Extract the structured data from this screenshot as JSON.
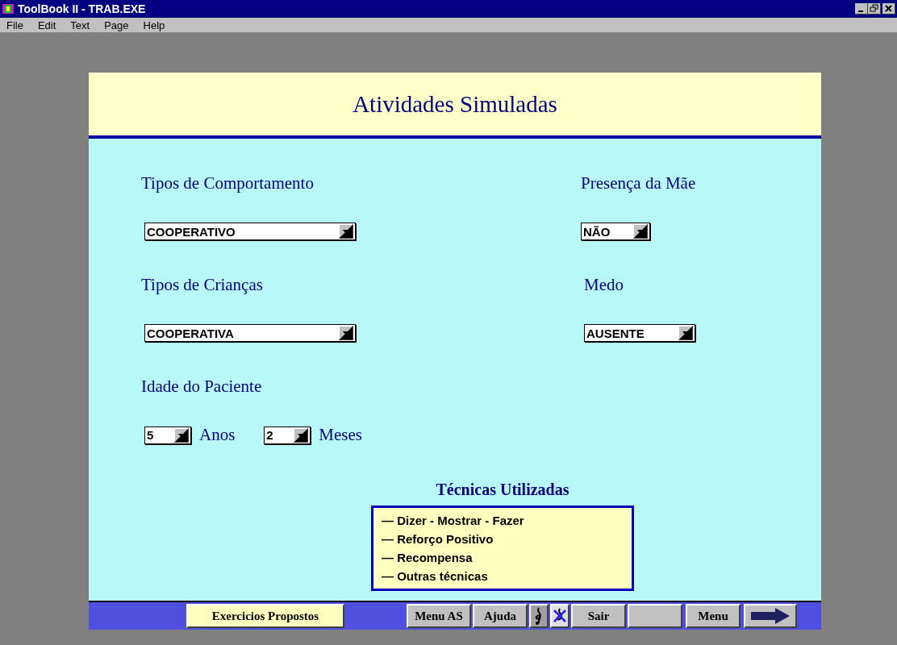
{
  "window": {
    "title": "ToolBook II - TRAB.EXE"
  },
  "menu": [
    "File",
    "Edit",
    "Text",
    "Page",
    "Help"
  ],
  "page": {
    "title": "Atividades Simuladas",
    "left": [
      {
        "kind": "label",
        "text": "Tipos de Comportamento"
      },
      {
        "kind": "combo",
        "value": "COOPERATIVO"
      },
      {
        "kind": "label",
        "text": "Tipos de Crianças"
      },
      {
        "kind": "combo",
        "value": "COOPERATIVA"
      },
      {
        "kind": "label",
        "text": "Idade do Paciente"
      },
      {
        "kind": "age",
        "years": "5",
        "years_unit": "Anos",
        "months": "2",
        "months_unit": "Meses"
      }
    ],
    "right": [
      {
        "kind": "label",
        "text": "Presença da Mãe"
      },
      {
        "kind": "combo",
        "value": "NÃO"
      },
      {
        "kind": "label",
        "text": "Medo"
      },
      {
        "kind": "combo",
        "value": "AUSENTE"
      }
    ],
    "techniques": {
      "title": "Técnicas Utilizadas",
      "items": [
        "— Dizer - Mostrar - Fazer",
        "— Reforço Positivo",
        "— Recompensa",
        "— Outras técnicas"
      ]
    }
  },
  "toolbar": [
    {
      "kind": "highlight",
      "label": "Exercicios Propostos"
    },
    {
      "kind": "text",
      "label": "Menu AS"
    },
    {
      "kind": "text",
      "label": "Ajuda"
    },
    {
      "kind": "music"
    },
    {
      "kind": "mute"
    },
    {
      "kind": "text",
      "label": "Sair"
    },
    {
      "kind": "blank"
    },
    {
      "kind": "text",
      "label": "Menu"
    },
    {
      "kind": "arrow"
    }
  ]
}
